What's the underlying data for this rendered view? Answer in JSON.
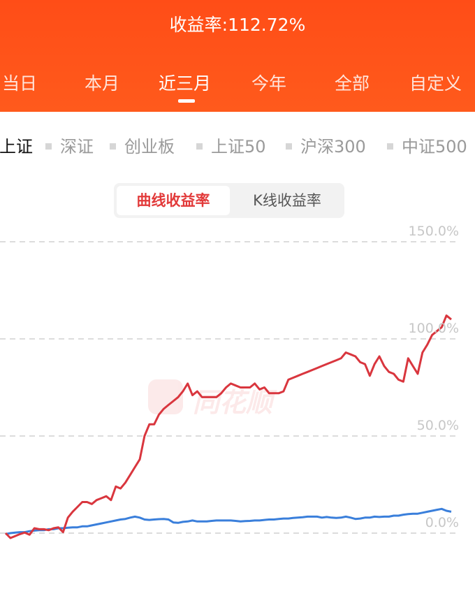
{
  "header": {
    "title": "收益率:112.72%",
    "tabs": [
      "当日",
      "本月",
      "近三月",
      "今年",
      "全部",
      "自定义"
    ],
    "active_tab": "近三月"
  },
  "indices": [
    "上证",
    "深证",
    "创业板",
    "上证50",
    "沪深300",
    "中证500"
  ],
  "active_index": "上证",
  "toggle": {
    "curve_label": "曲线收益率",
    "kline_label": "K线收益率",
    "active": "曲线收益率"
  },
  "watermark": "同花顺",
  "colors": {
    "header": "#ff4d17",
    "strategy_line": "#d9363e",
    "index_line": "#3a7fdb"
  },
  "chart_data": {
    "type": "line",
    "y_tick_labels": [
      "150.0%",
      "100.0%",
      "50.0%",
      "0.0%"
    ],
    "ylim": [
      0,
      150
    ],
    "grid": true,
    "series": [
      {
        "color": "#d9363e",
        "values": [
          0,
          -2.5,
          -1.5,
          -0.5,
          0.3,
          -0.8,
          2.5,
          2,
          2,
          1.5,
          2.5,
          3,
          0.5,
          8,
          11,
          13.5,
          16,
          16,
          15,
          17,
          18,
          19,
          17,
          24,
          23,
          26,
          30,
          34,
          38,
          50,
          56,
          56,
          61,
          64,
          66,
          68,
          70,
          73,
          77,
          71,
          73,
          70,
          70,
          70,
          70,
          72,
          75,
          77,
          76,
          75,
          75,
          75,
          77,
          74,
          75,
          72,
          72,
          72,
          73,
          79,
          80,
          81,
          82,
          83,
          84,
          85,
          86,
          87,
          88,
          89,
          90,
          93,
          92,
          91,
          88,
          87,
          81,
          87,
          91,
          86,
          83,
          82,
          79,
          78,
          90,
          86,
          82,
          93,
          97,
          102,
          104,
          106,
          112,
          110
        ],
        "end_value": 112.72
      },
      {
        "color": "#3a7fdb",
        "values": [
          -0.5,
          0,
          0.3,
          0.5,
          0.5,
          1,
          1.3,
          1.5,
          1.5,
          2,
          2,
          2.5,
          2.5,
          2.8,
          3,
          3,
          3.5,
          3.5,
          4,
          4.5,
          5,
          5.5,
          6,
          6.5,
          7,
          7.3,
          8,
          8.5,
          8,
          7,
          6.8,
          7,
          7.2,
          7.3,
          7,
          5.5,
          5.3,
          5.8,
          6,
          6.5,
          6,
          6,
          6,
          6.3,
          6.5,
          6.5,
          6.5,
          6.5,
          6.3,
          6,
          6.2,
          6.3,
          6.5,
          6.5,
          6.8,
          7,
          7,
          7.3,
          7.5,
          7.5,
          7.8,
          8,
          8.2,
          8.5,
          8.5,
          8.5,
          8,
          8.3,
          8,
          7.8,
          8,
          8.5,
          8,
          7.3,
          7.5,
          8,
          8,
          8.5,
          8.3,
          8.5,
          8.5,
          9,
          9,
          9.5,
          9.8,
          10,
          10,
          10.5,
          11,
          11.5,
          12,
          12.5,
          11.5,
          11
        ]
      }
    ]
  }
}
